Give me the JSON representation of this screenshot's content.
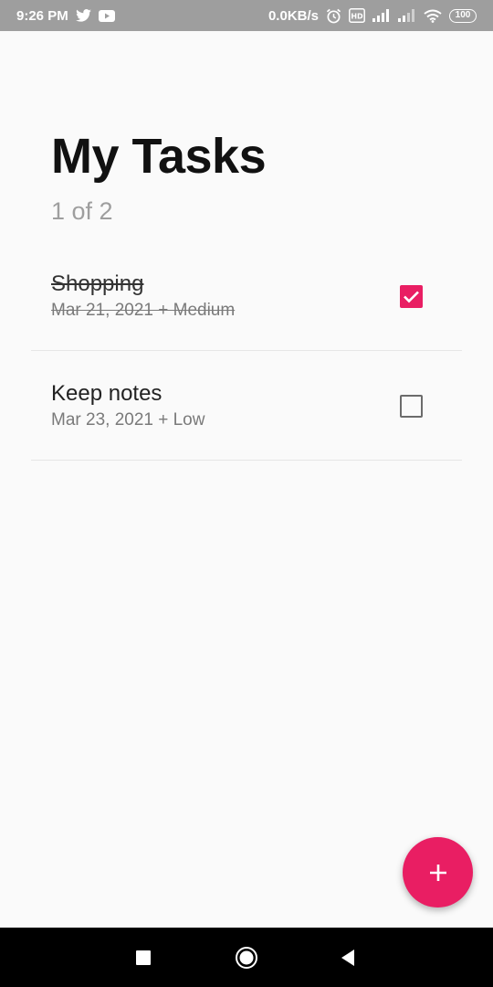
{
  "status_bar": {
    "time": "9:26 PM",
    "left_icons": [
      "twitter-icon",
      "youtube-icon"
    ],
    "network_speed": "0.0KB/s",
    "right_icons": [
      "alarm-icon",
      "volte-icon",
      "signal-icon",
      "signal-icon",
      "wifi-icon"
    ],
    "battery": "100"
  },
  "header": {
    "title": "My Tasks",
    "count": "1 of 2"
  },
  "tasks": [
    {
      "title": "Shopping",
      "meta": "Mar 21, 2021 + Medium",
      "completed": true
    },
    {
      "title": "Keep notes",
      "meta": "Mar 23, 2021 + Low",
      "completed": false
    }
  ],
  "fab": {
    "icon": "plus-icon"
  },
  "nav_bar": {
    "icons": [
      "recents-icon",
      "home-icon",
      "back-icon"
    ]
  },
  "colors": {
    "accent": "#e91e63",
    "status_bar": "#9e9e9e",
    "background": "#fafafa"
  }
}
